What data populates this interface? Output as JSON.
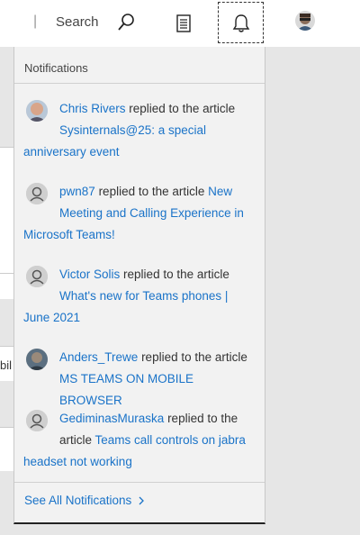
{
  "header": {
    "search_label": "Search"
  },
  "panel": {
    "title": "Notifications",
    "see_all": "See All Notifications",
    "notifications": [
      {
        "user": "Chris Rivers",
        "action": "replied to the article",
        "line2": "Sysinternals@25: a special",
        "line3": "anniversary event"
      },
      {
        "user": "pwn87",
        "action": "replied to the article",
        "link1": "New",
        "line2": "Meeting and Calling Experience in",
        "line3": "Microsoft Teams!"
      },
      {
        "user": "Victor Solis",
        "action": "replied to the article",
        "line2": "What's new for Teams phones |",
        "line3": "June 2021"
      },
      {
        "user": "Anders_Trewe",
        "action": "replied to the article",
        "line2": "MS TEAMS ON MOBILE BROWSER"
      },
      {
        "user": "GediminasMuraska",
        "action": "replied to the",
        "action2": "article",
        "link2": "Teams call controls on jabra",
        "line3": "headset not working"
      }
    ]
  },
  "background": {
    "partial_text": "bil"
  },
  "colors": {
    "link": "#1a73c8",
    "panel_bg": "#f2f2f2",
    "page_bg": "#e6e6e6"
  }
}
